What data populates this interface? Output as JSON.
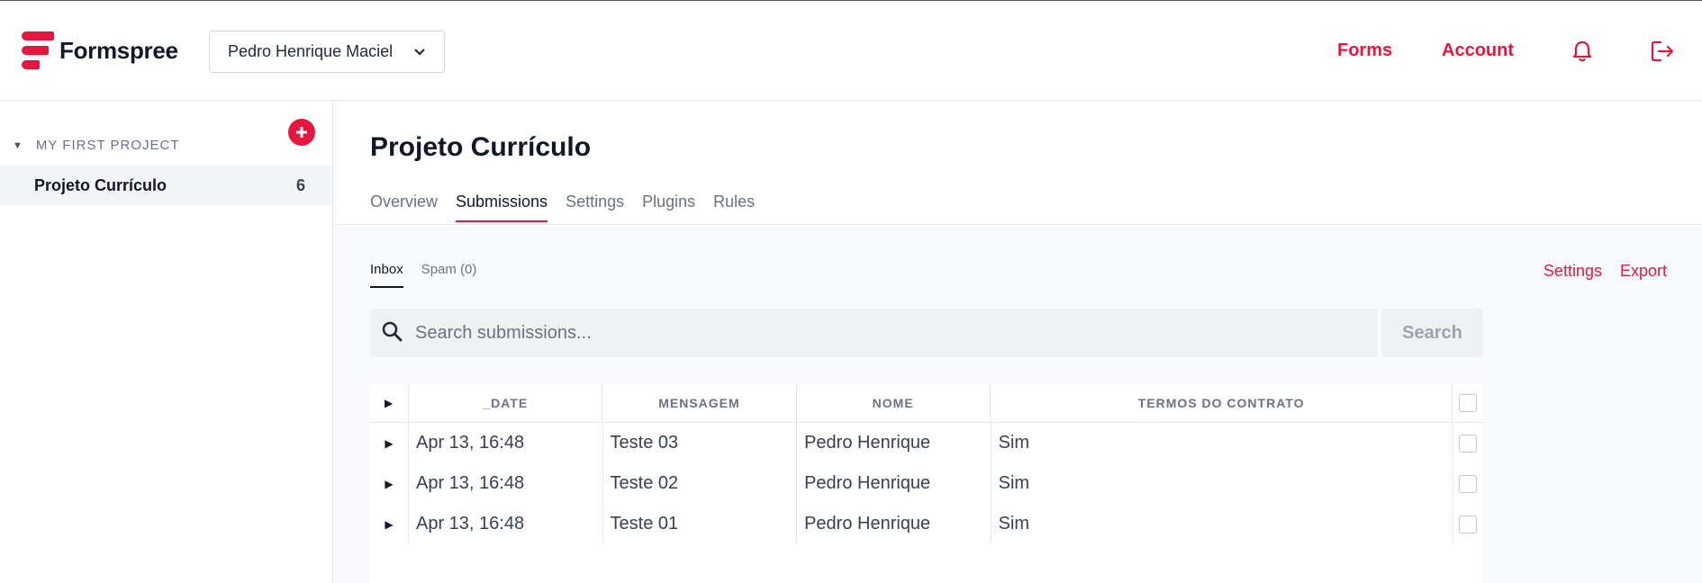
{
  "colors": {
    "accent": "#e5173f",
    "text": "#111827",
    "muted": "#6b7280"
  },
  "header": {
    "brand": "Formspree",
    "account_selector": "Pedro Henrique Maciel",
    "nav": {
      "forms": "Forms",
      "account": "Account"
    },
    "icons": {
      "notifications": "bell-icon",
      "logout": "logout-icon"
    }
  },
  "sidebar": {
    "project_name": "MY FIRST PROJECT",
    "forms": [
      {
        "label": "Projeto Currículo",
        "count": "6"
      }
    ]
  },
  "main": {
    "title": "Projeto Currículo",
    "tabs": [
      {
        "label": "Overview"
      },
      {
        "label": "Submissions",
        "active": true
      },
      {
        "label": "Settings"
      },
      {
        "label": "Plugins"
      },
      {
        "label": "Rules"
      }
    ],
    "subtabs": [
      {
        "label": "Inbox",
        "active": true
      },
      {
        "label": "Spam (0)"
      }
    ],
    "actions": {
      "settings": "Settings",
      "export": "Export"
    },
    "search": {
      "placeholder": "Search submissions...",
      "button": "Search"
    },
    "table": {
      "columns": [
        "_DATE",
        "MENSAGEM",
        "NOME",
        "TERMOS DO CONTRATO"
      ],
      "rows": [
        [
          "Apr 13, 16:48",
          "Teste 03",
          "Pedro Henrique",
          "Sim"
        ],
        [
          "Apr 13, 16:48",
          "Teste 02",
          "Pedro Henrique",
          "Sim"
        ],
        [
          "Apr 13, 16:48",
          "Teste 01",
          "Pedro Henrique",
          "Sim"
        ]
      ]
    }
  }
}
